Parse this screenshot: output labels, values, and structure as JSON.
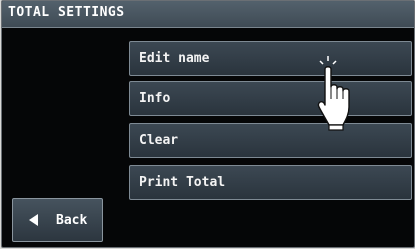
{
  "header": {
    "title": "TOTAL SETTINGS"
  },
  "menu": {
    "items": [
      {
        "label": "Edit name"
      },
      {
        "label": "Info"
      },
      {
        "label": "Clear"
      },
      {
        "label": "Print Total"
      }
    ]
  },
  "footer": {
    "back_label": "Back"
  },
  "icons": {
    "pointer": "hand-pointer-icon",
    "back": "left-triangle-icon"
  },
  "colors": {
    "title_bar": "#4a5762",
    "button_fill": "#333e48",
    "button_border": "#7e8a94",
    "screen_background": "#050607",
    "text": "#ffffff"
  }
}
